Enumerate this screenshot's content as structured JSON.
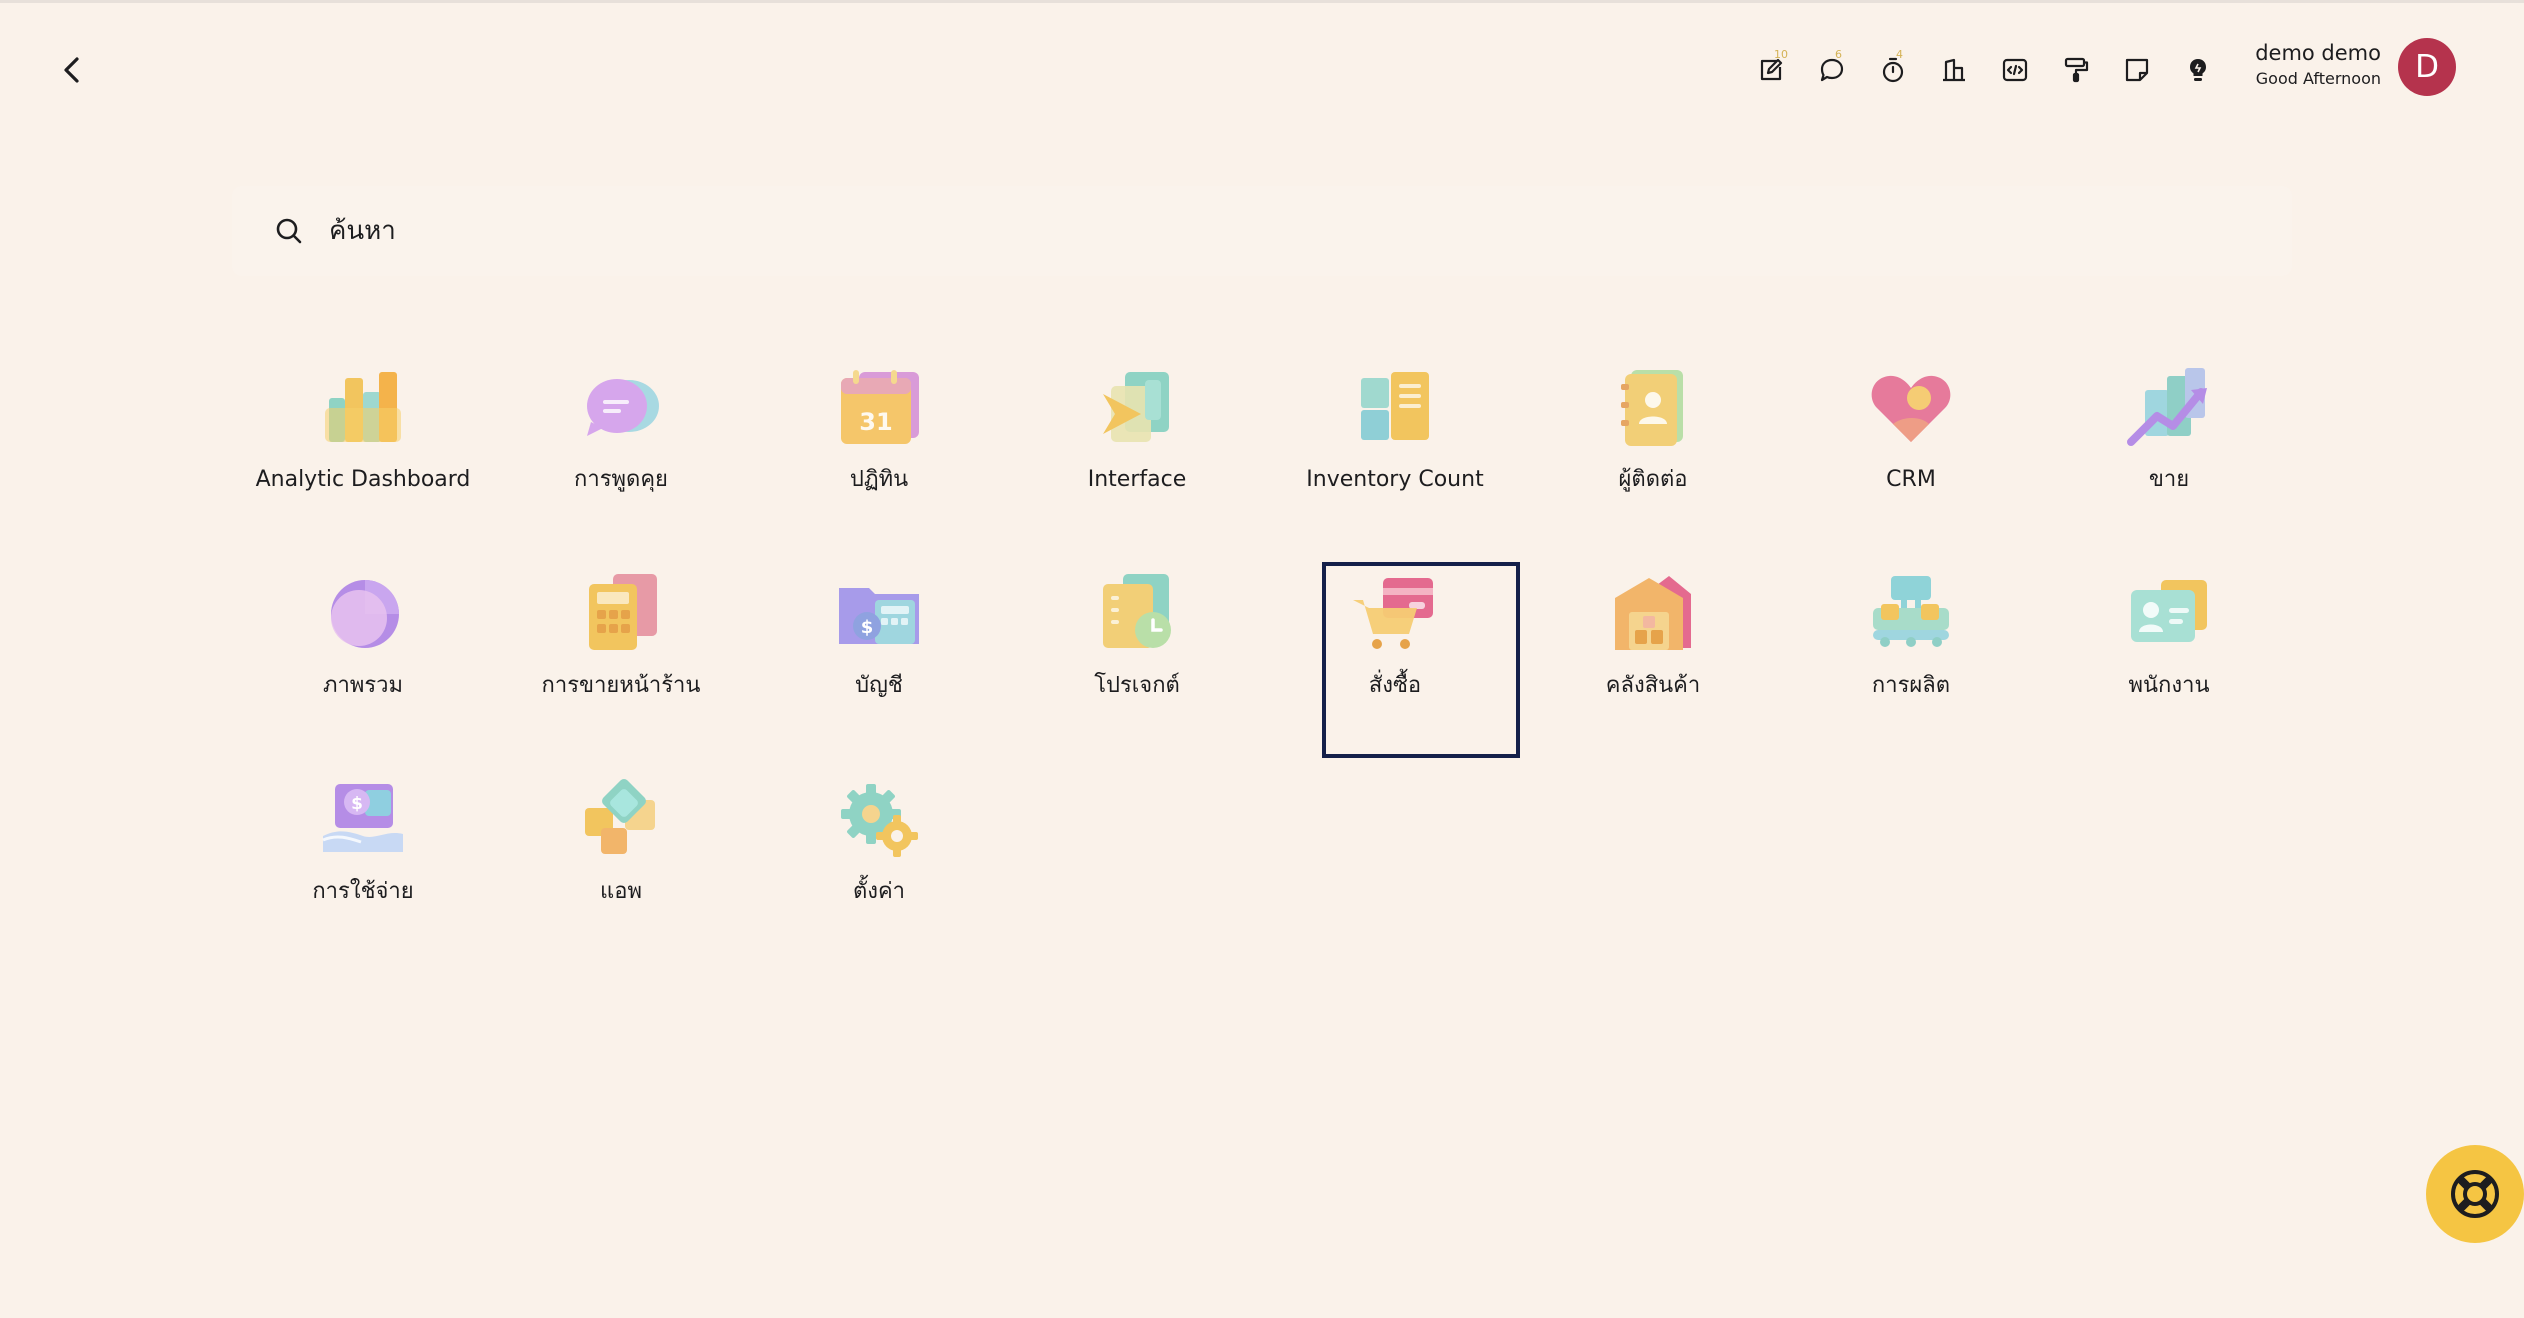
{
  "toolbar": {
    "tools": [
      {
        "icon": "edit-activity-icon",
        "badge": "10"
      },
      {
        "icon": "chat-icon",
        "badge": "6"
      },
      {
        "icon": "timer-icon",
        "badge": "4"
      },
      {
        "icon": "company-icon",
        "badge": ""
      },
      {
        "icon": "code-icon",
        "badge": ""
      },
      {
        "icon": "paint-roller-icon",
        "badge": ""
      },
      {
        "icon": "note-icon",
        "badge": ""
      },
      {
        "icon": "lightbulb-icon",
        "badge": ""
      }
    ]
  },
  "user": {
    "name": "demo demo",
    "greeting": "Good Afternoon",
    "initial": "D",
    "avatar_color": "#b5334d"
  },
  "search": {
    "placeholder": "ค้นหา"
  },
  "apps": [
    {
      "label": "Analytic Dashboard",
      "icon": "bar-chart-icon"
    },
    {
      "label": "การพูดคุย",
      "icon": "chat-bubble-icon"
    },
    {
      "label": "ปฏิทิน",
      "icon": "calendar-icon",
      "number": "31"
    },
    {
      "label": "Interface",
      "icon": "interface-arrow-icon"
    },
    {
      "label": "Inventory Count",
      "icon": "inventory-count-icon"
    },
    {
      "label": "ผู้ติดต่อ",
      "icon": "contact-book-icon"
    },
    {
      "label": "CRM",
      "icon": "heart-icon"
    },
    {
      "label": "ขาย",
      "icon": "sales-chart-icon"
    },
    {
      "label": "ภาพรวม",
      "icon": "pie-chart-icon"
    },
    {
      "label": "การขายหน้าร้าน",
      "icon": "pos-calculator-icon"
    },
    {
      "label": "บัญชี",
      "icon": "accounting-folder-icon"
    },
    {
      "label": "โปรเจกต์",
      "icon": "project-clock-icon"
    },
    {
      "label": "สั่งซื้อ",
      "icon": "shopping-cart-icon",
      "selected": true
    },
    {
      "label": "คลังสินค้า",
      "icon": "warehouse-icon"
    },
    {
      "label": "การผลิต",
      "icon": "manufacturing-icon"
    },
    {
      "label": "พนักงาน",
      "icon": "employee-card-icon"
    },
    {
      "label": "การใช้จ่าย",
      "icon": "expense-hand-icon"
    },
    {
      "label": "แอพ",
      "icon": "apps-diamond-icon"
    },
    {
      "label": "ตั้งค่า",
      "icon": "settings-gear-icon"
    }
  ],
  "accent_colors": {
    "background": "#faf2ea",
    "selection": "#14204a",
    "help_button": "#f5c543",
    "badge": "#d4b256"
  }
}
